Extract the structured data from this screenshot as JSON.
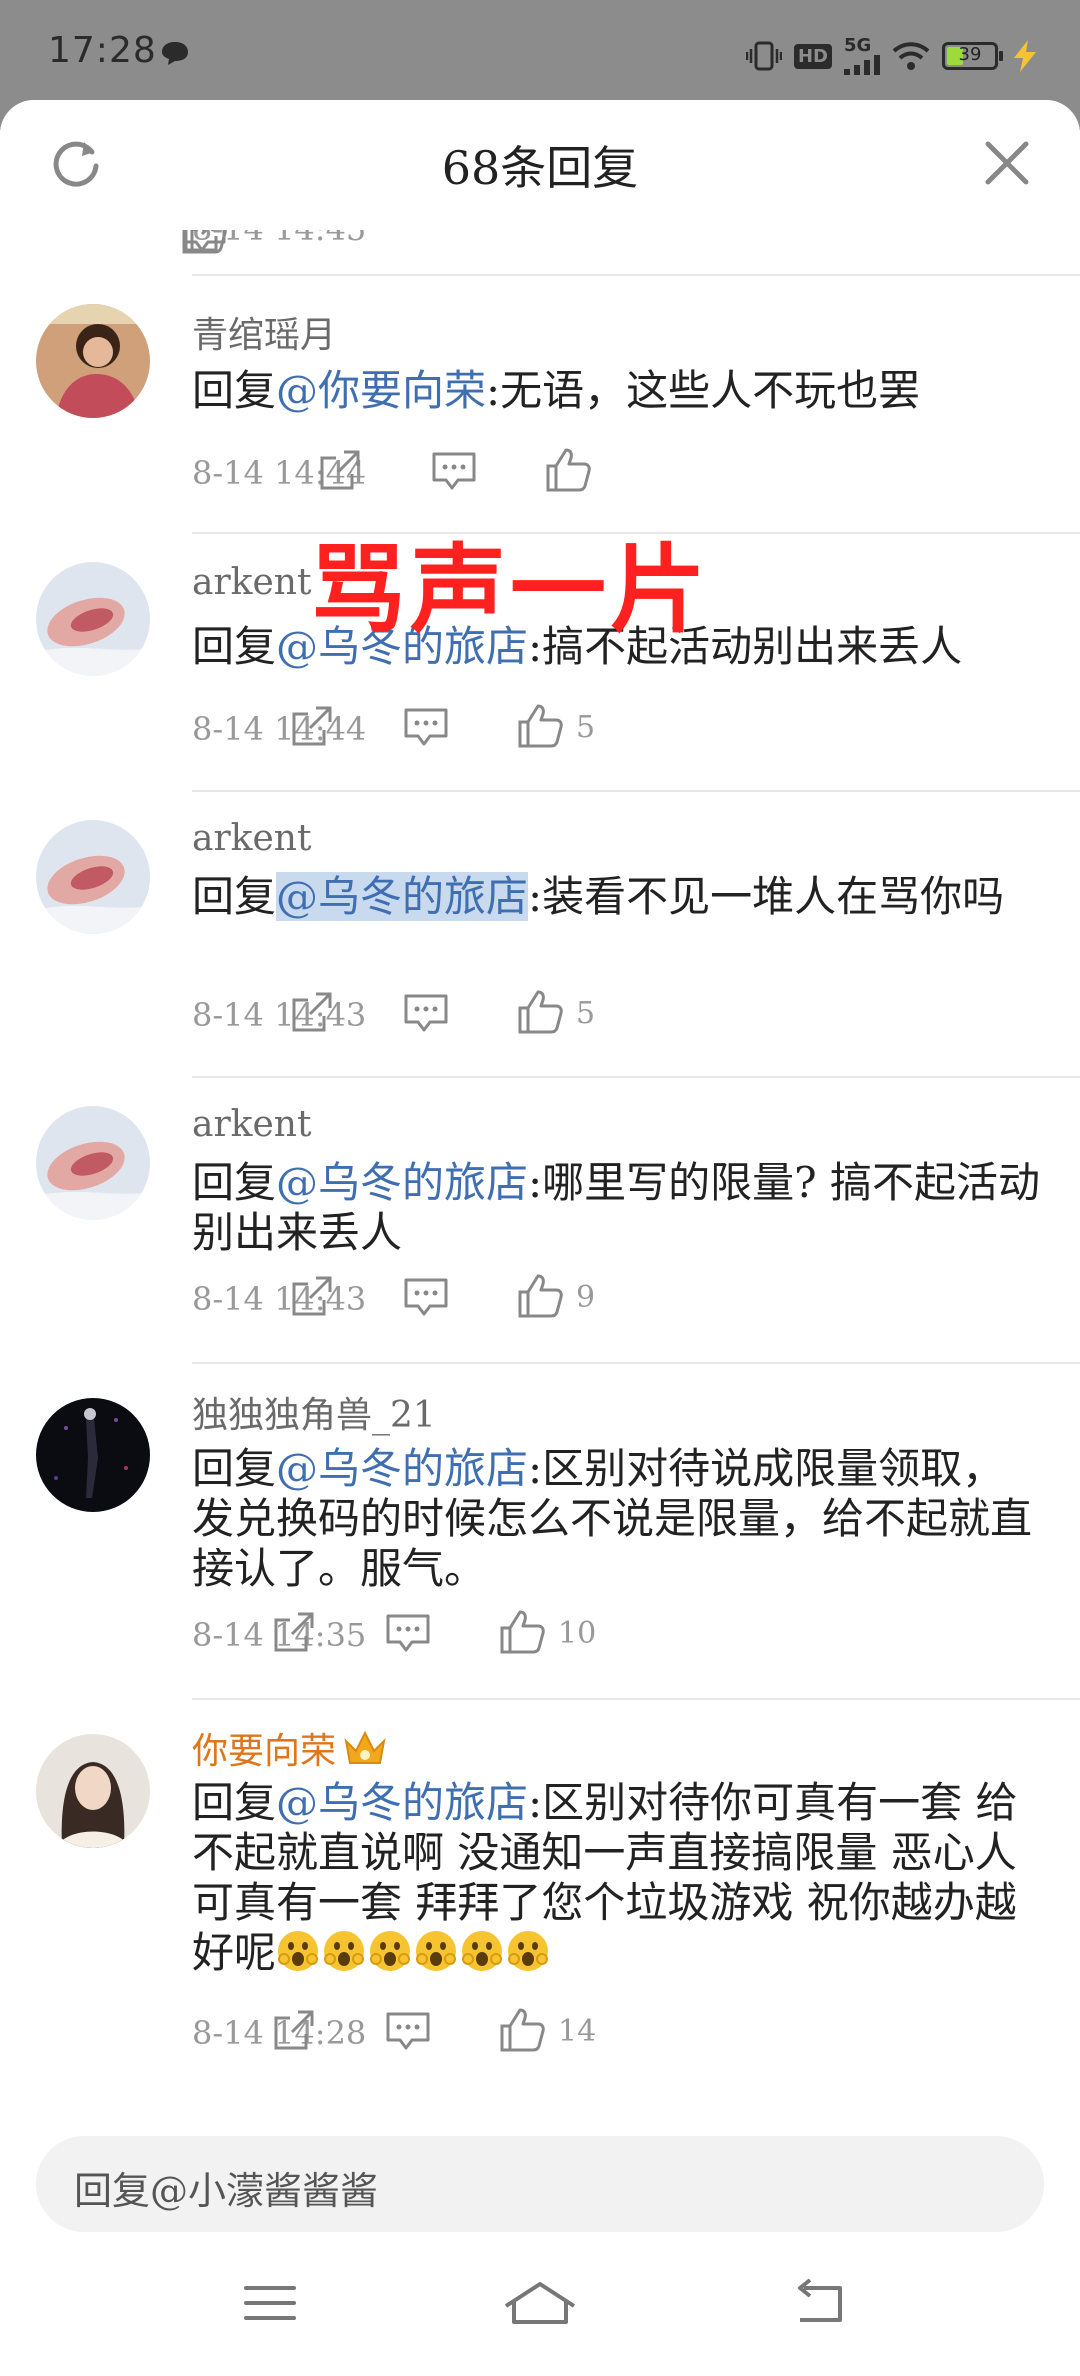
{
  "status_bar": {
    "time": "17:28",
    "hd_label": "HD",
    "network_label": "5G",
    "battery": "39",
    "battery_level": 0.39
  },
  "header": {
    "title": "68条回复"
  },
  "overlay": {
    "text": "骂声一片"
  },
  "comments": [
    {
      "author": "青绾瑶月",
      "reply_prefix": "回复",
      "mention": "@你要向荣",
      "body": ":无语，这些人不玩也罢",
      "date": "8-14  14:44",
      "likes": ""
    },
    {
      "author": "arkent",
      "reply_prefix": "回复",
      "mention": "@乌冬的旅店",
      "body": ":搞不起活动别出来丢人",
      "date": "8-14  14:44",
      "likes": "5"
    },
    {
      "author": "arkent",
      "reply_prefix": "回复",
      "mention": "@乌冬的旅店",
      "body": ":装看不见一堆人在骂你吗",
      "date": "8-14  14:43",
      "likes": "5"
    },
    {
      "author": "arkent",
      "reply_prefix": "回复",
      "mention": "@乌冬的旅店",
      "body": ":哪里写的限量? 搞不起活动别出来丢人",
      "date": "8-14  14:43",
      "likes": "9"
    },
    {
      "author": "独独独角兽_21",
      "reply_prefix": "回复",
      "mention": "@乌冬的旅店",
      "body": ":区别对待说成限量领取，发兑换码的时候怎么不说是限量，给不起就直接认了。服气。",
      "date": "8-14  14:35",
      "likes": "10"
    },
    {
      "author": "你要向荣",
      "reply_prefix": "回复",
      "mention": "@乌冬的旅店",
      "body": ":区别对待你可真有一套  给不起就直说啊  没通知一声直接搞限量  恶心人可真有一套  拜拜了您个垃圾游戏  祝你越办越好呢",
      "date": "8-14  14:28",
      "likes": "14"
    }
  ],
  "reply_bar": {
    "placeholder": "回复@小濛酱酱酱"
  },
  "icons": {
    "refresh": "refresh-icon",
    "close": "close-icon",
    "share": "share-icon",
    "comment": "comment-icon",
    "like": "like-icon",
    "menu": "menu-icon",
    "home": "home-icon",
    "back": "back-icon"
  },
  "colors": {
    "mention": "#3f6fb0",
    "vip_name": "#e0761b",
    "overlay": "#ff2020"
  }
}
